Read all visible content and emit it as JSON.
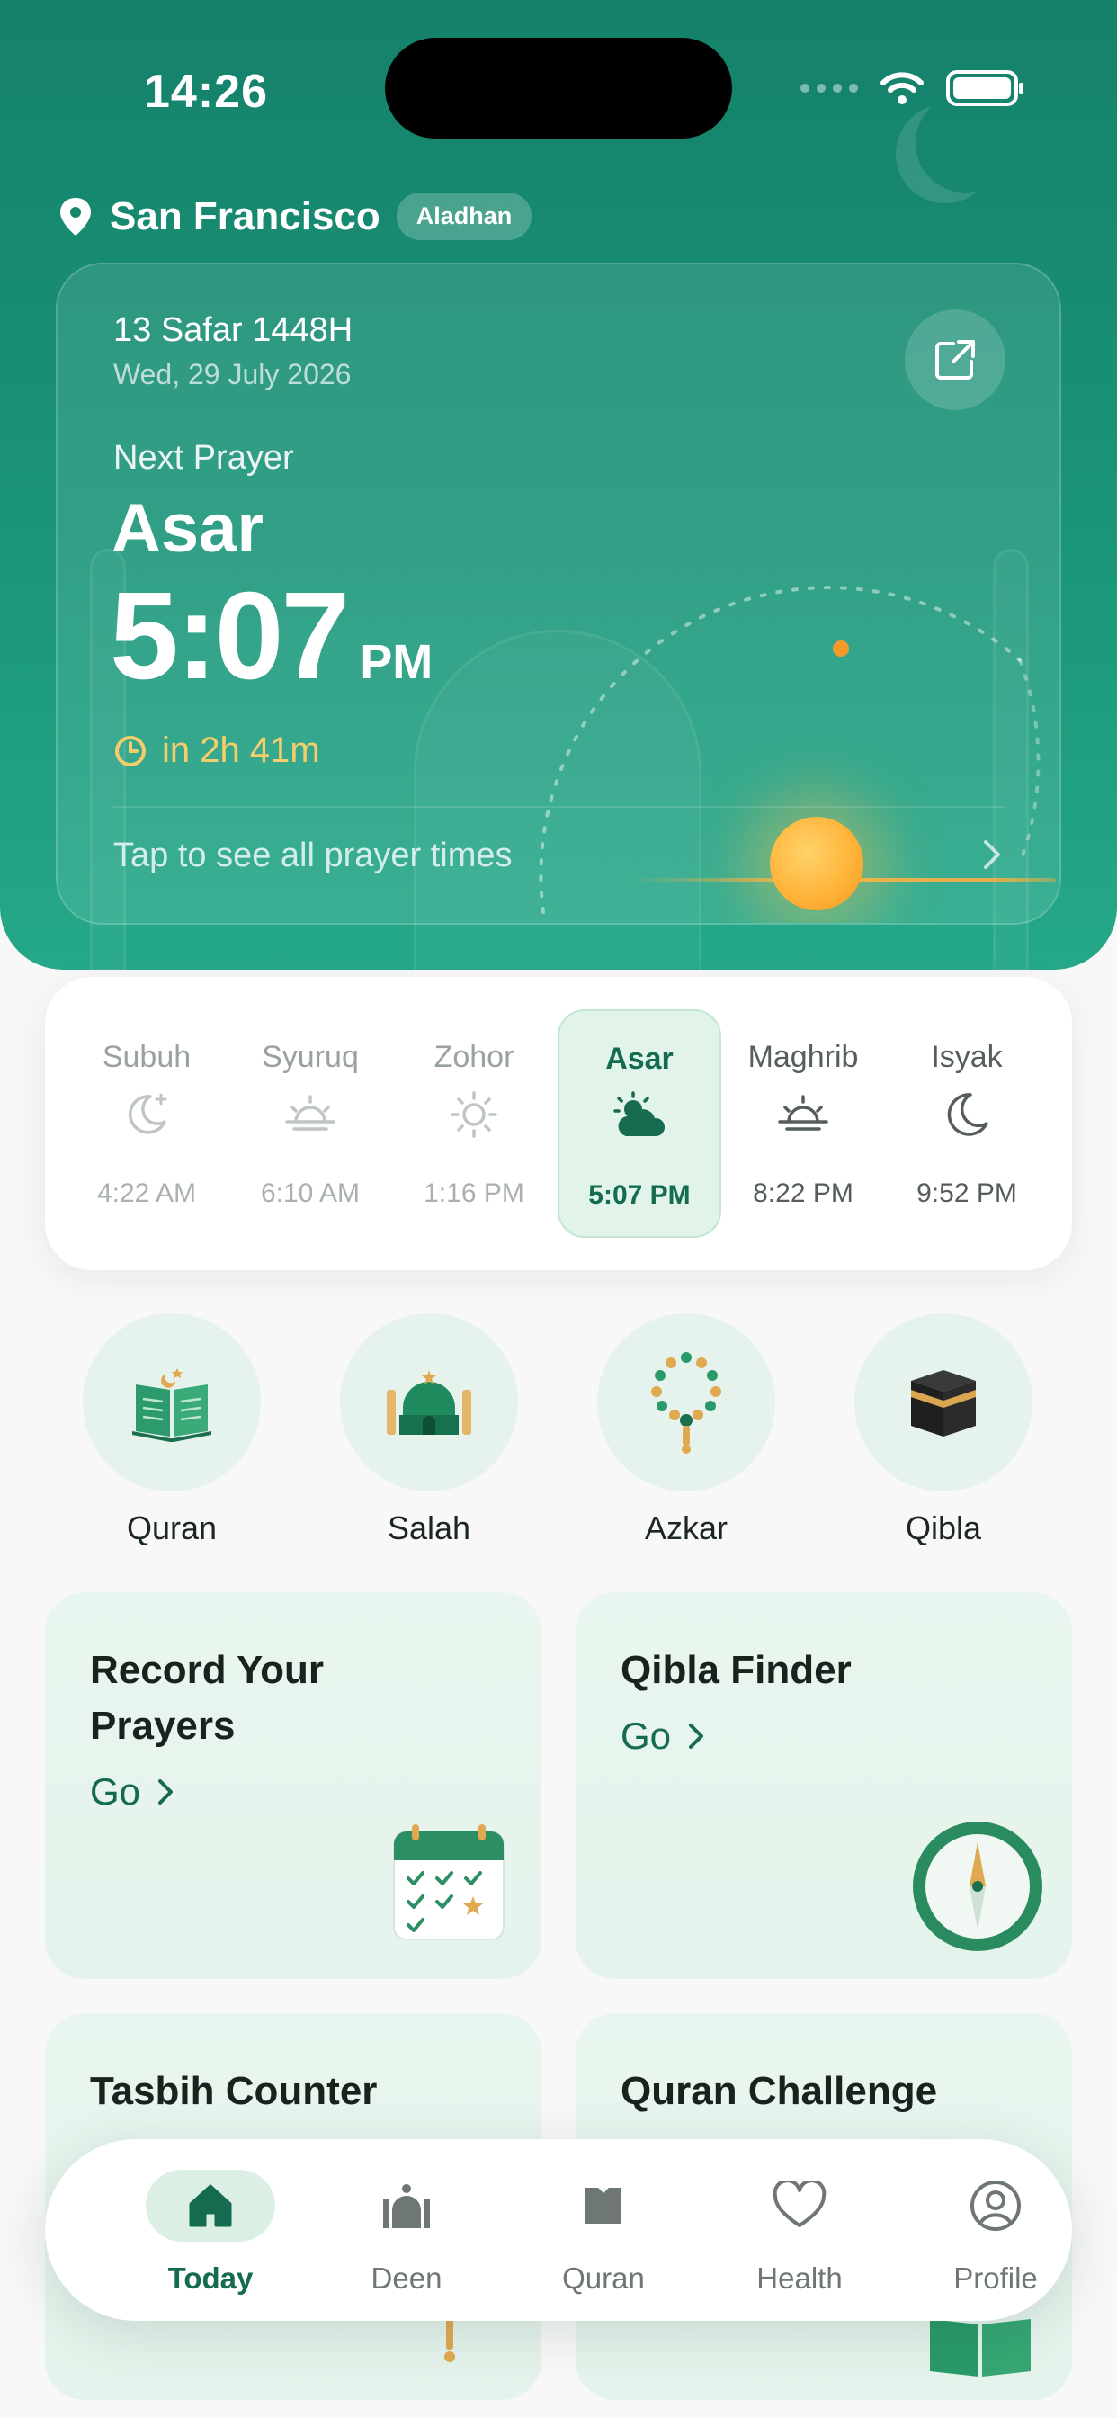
{
  "status_bar": {
    "time": "14:26"
  },
  "header": {
    "city": "San Francisco",
    "source_badge": "Aladhan",
    "icons": {
      "location": "location-pin-icon",
      "external": "external-link-icon"
    }
  },
  "hero": {
    "hijri_date": "13 Safar 1448H",
    "gregorian_date": "Wed, 29 July 2026",
    "next_label": "Next Prayer",
    "next_name": "Asar",
    "next_time": "5:07",
    "next_ampm": "PM",
    "countdown": "in 2h 41m",
    "tap_text": "Tap to see all prayer times",
    "colors": {
      "countdown": "#f5cd6b",
      "primary": "#15816a"
    }
  },
  "prayers": [
    {
      "name": "Subuh",
      "time": "4:22 AM",
      "icon": "moon-stars-icon"
    },
    {
      "name": "Syuruq",
      "time": "6:10 AM",
      "icon": "sunrise-icon"
    },
    {
      "name": "Zohor",
      "time": "1:16 PM",
      "icon": "sun-icon"
    },
    {
      "name": "Asar",
      "time": "5:07 PM",
      "icon": "sun-cloud-icon",
      "active": true
    },
    {
      "name": "Maghrib",
      "time": "8:22 PM",
      "icon": "sunset-icon"
    },
    {
      "name": "Isyak",
      "time": "9:52 PM",
      "icon": "moon-icon"
    }
  ],
  "quick_actions": [
    {
      "label": "Quran",
      "icon": "quran-book-icon"
    },
    {
      "label": "Salah",
      "icon": "mosque-icon"
    },
    {
      "label": "Azkar",
      "icon": "prayer-beads-icon"
    },
    {
      "label": "Qibla",
      "icon": "kaaba-icon"
    }
  ],
  "cards": {
    "record": {
      "title_line1": "Record Your",
      "title_line2": "Prayers",
      "go": "Go",
      "icon": "calendar-check-icon"
    },
    "qibla": {
      "title": "Qibla Finder",
      "go": "Go",
      "icon": "compass-icon"
    },
    "tasbih": {
      "title": "Tasbih Counter"
    },
    "challenge": {
      "title": "Quran Challenge"
    }
  },
  "tabs": [
    {
      "label": "Today",
      "icon": "home-icon",
      "active": true
    },
    {
      "label": "Deen",
      "icon": "deen-icon"
    },
    {
      "label": "Quran",
      "icon": "book-icon"
    },
    {
      "label": "Health",
      "icon": "heart-icon"
    },
    {
      "label": "Profile",
      "icon": "profile-icon"
    }
  ]
}
